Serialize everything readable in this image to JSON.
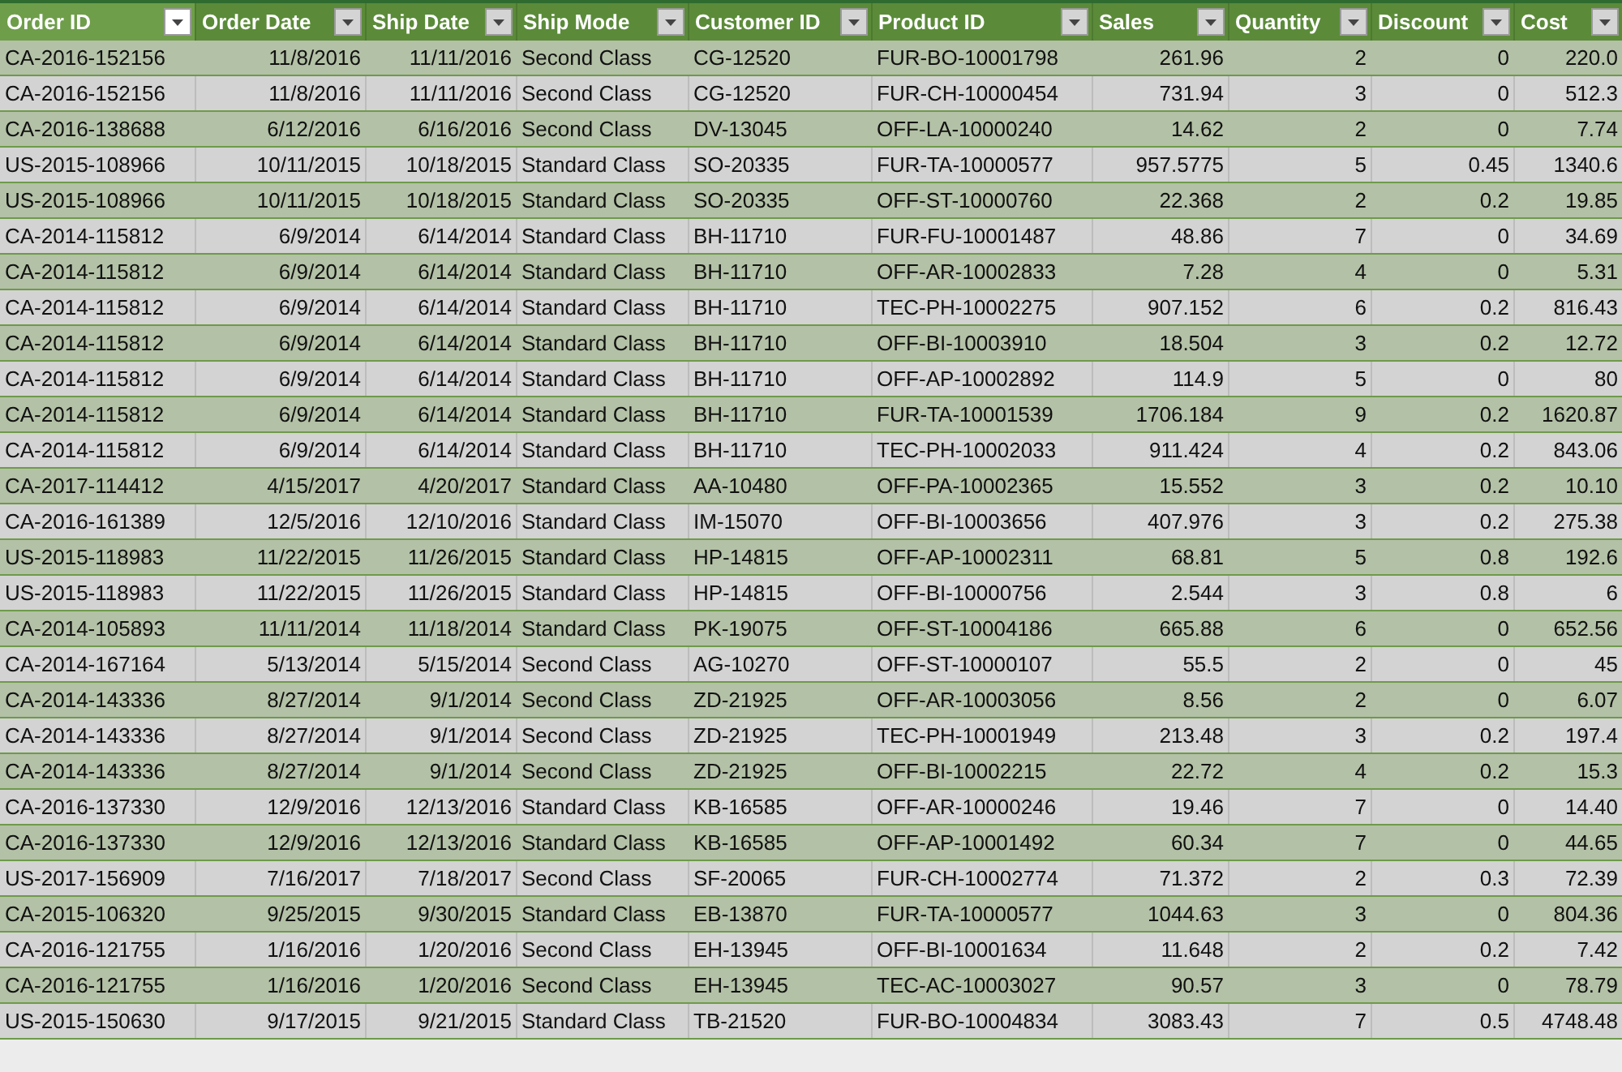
{
  "table": {
    "columns": [
      {
        "label": "Order ID",
        "selected": true
      },
      {
        "label": "Order Date",
        "selected": false
      },
      {
        "label": "Ship Date",
        "selected": false
      },
      {
        "label": "Ship Mode",
        "selected": false
      },
      {
        "label": "Customer ID",
        "selected": false
      },
      {
        "label": "Product ID",
        "selected": false
      },
      {
        "label": "Sales",
        "selected": false
      },
      {
        "label": "Quantity",
        "selected": false
      },
      {
        "label": "Discount",
        "selected": false
      },
      {
        "label": "Cost",
        "selected": false
      }
    ],
    "rows": [
      [
        "CA-2016-152156",
        "11/8/2016",
        "11/11/2016",
        "Second Class",
        "CG-12520",
        "FUR-BO-10001798",
        "261.96",
        "2",
        "0",
        "220.0"
      ],
      [
        "CA-2016-152156",
        "11/8/2016",
        "11/11/2016",
        "Second Class",
        "CG-12520",
        "FUR-CH-10000454",
        "731.94",
        "3",
        "0",
        "512.3"
      ],
      [
        "CA-2016-138688",
        "6/12/2016",
        "6/16/2016",
        "Second Class",
        "DV-13045",
        "OFF-LA-10000240",
        "14.62",
        "2",
        "0",
        "7.74"
      ],
      [
        "US-2015-108966",
        "10/11/2015",
        "10/18/2015",
        "Standard Class",
        "SO-20335",
        "FUR-TA-10000577",
        "957.5775",
        "5",
        "0.45",
        "1340.6"
      ],
      [
        "US-2015-108966",
        "10/11/2015",
        "10/18/2015",
        "Standard Class",
        "SO-20335",
        "OFF-ST-10000760",
        "22.368",
        "2",
        "0.2",
        "19.85"
      ],
      [
        "CA-2014-115812",
        "6/9/2014",
        "6/14/2014",
        "Standard Class",
        "BH-11710",
        "FUR-FU-10001487",
        "48.86",
        "7",
        "0",
        "34.69"
      ],
      [
        "CA-2014-115812",
        "6/9/2014",
        "6/14/2014",
        "Standard Class",
        "BH-11710",
        "OFF-AR-10002833",
        "7.28",
        "4",
        "0",
        "5.31"
      ],
      [
        "CA-2014-115812",
        "6/9/2014",
        "6/14/2014",
        "Standard Class",
        "BH-11710",
        "TEC-PH-10002275",
        "907.152",
        "6",
        "0.2",
        "816.43"
      ],
      [
        "CA-2014-115812",
        "6/9/2014",
        "6/14/2014",
        "Standard Class",
        "BH-11710",
        "OFF-BI-10003910",
        "18.504",
        "3",
        "0.2",
        "12.72"
      ],
      [
        "CA-2014-115812",
        "6/9/2014",
        "6/14/2014",
        "Standard Class",
        "BH-11710",
        "OFF-AP-10002892",
        "114.9",
        "5",
        "0",
        "80"
      ],
      [
        "CA-2014-115812",
        "6/9/2014",
        "6/14/2014",
        "Standard Class",
        "BH-11710",
        "FUR-TA-10001539",
        "1706.184",
        "9",
        "0.2",
        "1620.87"
      ],
      [
        "CA-2014-115812",
        "6/9/2014",
        "6/14/2014",
        "Standard Class",
        "BH-11710",
        "TEC-PH-10002033",
        "911.424",
        "4",
        "0.2",
        "843.06"
      ],
      [
        "CA-2017-114412",
        "4/15/2017",
        "4/20/2017",
        "Standard Class",
        "AA-10480",
        "OFF-PA-10002365",
        "15.552",
        "3",
        "0.2",
        "10.10"
      ],
      [
        "CA-2016-161389",
        "12/5/2016",
        "12/10/2016",
        "Standard Class",
        "IM-15070",
        "OFF-BI-10003656",
        "407.976",
        "3",
        "0.2",
        "275.38"
      ],
      [
        "US-2015-118983",
        "11/22/2015",
        "11/26/2015",
        "Standard Class",
        "HP-14815",
        "OFF-AP-10002311",
        "68.81",
        "5",
        "0.8",
        "192.6"
      ],
      [
        "US-2015-118983",
        "11/22/2015",
        "11/26/2015",
        "Standard Class",
        "HP-14815",
        "OFF-BI-10000756",
        "2.544",
        "3",
        "0.8",
        "6"
      ],
      [
        "CA-2014-105893",
        "11/11/2014",
        "11/18/2014",
        "Standard Class",
        "PK-19075",
        "OFF-ST-10004186",
        "665.88",
        "6",
        "0",
        "652.56"
      ],
      [
        "CA-2014-167164",
        "5/13/2014",
        "5/15/2014",
        "Second Class",
        "AG-10270",
        "OFF-ST-10000107",
        "55.5",
        "2",
        "0",
        "45"
      ],
      [
        "CA-2014-143336",
        "8/27/2014",
        "9/1/2014",
        "Second Class",
        "ZD-21925",
        "OFF-AR-10003056",
        "8.56",
        "2",
        "0",
        "6.07"
      ],
      [
        "CA-2014-143336",
        "8/27/2014",
        "9/1/2014",
        "Second Class",
        "ZD-21925",
        "TEC-PH-10001949",
        "213.48",
        "3",
        "0.2",
        "197.4"
      ],
      [
        "CA-2014-143336",
        "8/27/2014",
        "9/1/2014",
        "Second Class",
        "ZD-21925",
        "OFF-BI-10002215",
        "22.72",
        "4",
        "0.2",
        "15.3"
      ],
      [
        "CA-2016-137330",
        "12/9/2016",
        "12/13/2016",
        "Standard Class",
        "KB-16585",
        "OFF-AR-10000246",
        "19.46",
        "7",
        "0",
        "14.40"
      ],
      [
        "CA-2016-137330",
        "12/9/2016",
        "12/13/2016",
        "Standard Class",
        "KB-16585",
        "OFF-AP-10001492",
        "60.34",
        "7",
        "0",
        "44.65"
      ],
      [
        "US-2017-156909",
        "7/16/2017",
        "7/18/2017",
        "Second Class",
        "SF-20065",
        "FUR-CH-10002774",
        "71.372",
        "2",
        "0.3",
        "72.39"
      ],
      [
        "CA-2015-106320",
        "9/25/2015",
        "9/30/2015",
        "Standard Class",
        "EB-13870",
        "FUR-TA-10000577",
        "1044.63",
        "3",
        "0",
        "804.36"
      ],
      [
        "CA-2016-121755",
        "1/16/2016",
        "1/20/2016",
        "Second Class",
        "EH-13945",
        "OFF-BI-10001634",
        "11.648",
        "2",
        "0.2",
        "7.42"
      ],
      [
        "CA-2016-121755",
        "1/16/2016",
        "1/20/2016",
        "Second Class",
        "EH-13945",
        "TEC-AC-10003027",
        "90.57",
        "3",
        "0",
        "78.79"
      ],
      [
        "US-2015-150630",
        "9/17/2015",
        "9/21/2015",
        "Standard Class",
        "TB-21520",
        "FUR-BO-10004834",
        "3083.43",
        "7",
        "0.5",
        "4748.48"
      ]
    ]
  }
}
